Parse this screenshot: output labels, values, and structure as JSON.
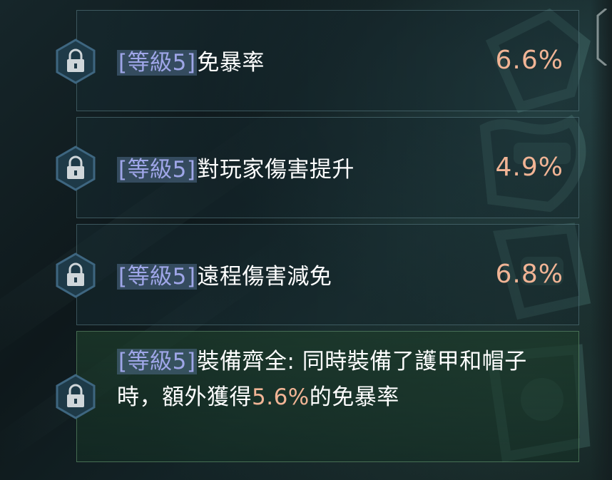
{
  "rows": [
    {
      "level_tag": "[等級5]",
      "name": "免暴率",
      "value": "6.6%"
    },
    {
      "level_tag": "[等級5]",
      "name": "對玩家傷害提升",
      "value": "4.9%"
    },
    {
      "level_tag": "[等級5]",
      "name": "遠程傷害減免",
      "value": "6.8%"
    }
  ],
  "set_bonus": {
    "level_tag": "[等級5]",
    "text_before": "裝備齊全: 同時裝備了護甲和帽子時，額外獲得",
    "highlight": "5.6%",
    "text_after": "的免暴率"
  },
  "colors": {
    "value": "#f1b495",
    "level_tag": "#9fa6e8",
    "set_panel": "#1c3a2a"
  },
  "icons": {
    "row_icon": "lock-icon"
  }
}
